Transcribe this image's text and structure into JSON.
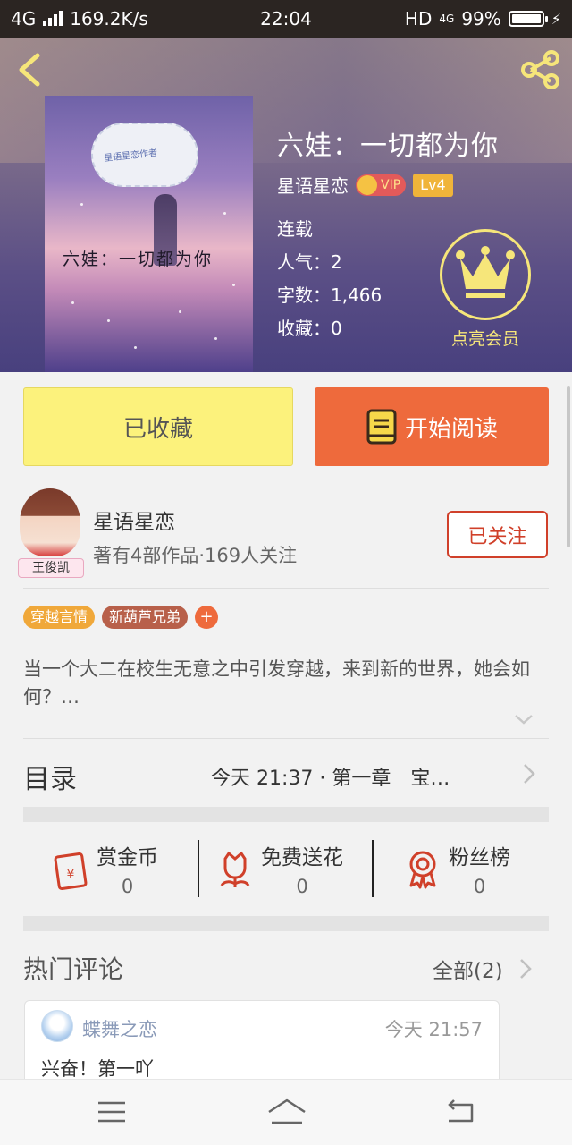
{
  "status_bar": {
    "network": "4G",
    "speed": "169.2K/s",
    "time": "22:04",
    "hd": "HD",
    "network_small": "4G",
    "battery": "99%"
  },
  "book": {
    "title": "六娃：一切都为你",
    "author": "星语星恋",
    "vip_label": "VIP",
    "level": "Lv4",
    "status": "连载",
    "popularity": "人气：2",
    "word_count": "字数：1,466",
    "favorites": "收藏：0",
    "membership_label": "点亮会员",
    "cover_title": "六娃：一切都为你",
    "cover_cloud_text": "星语星恋作者"
  },
  "actions": {
    "collected_label": "已收藏",
    "read_label": "开始阅读"
  },
  "author_card": {
    "name": "星语星恋",
    "stats": "著有4部作品·169人关注",
    "avatar_tag": "王俊凯",
    "follow_label": "已关注"
  },
  "tags": [
    {
      "label": "穿越言情",
      "color": "#f0a83a"
    },
    {
      "label": "新葫芦兄弟",
      "color": "#b8604a"
    }
  ],
  "tag_add": "+",
  "synopsis": "当一个大二在校生无意之中引发穿越，来到新的世界，她会如何？…",
  "toc": {
    "title": "目录",
    "latest": "今天 21:37 · 第一章　宝…"
  },
  "rewards": [
    {
      "label": "赏金币",
      "count": "0",
      "icon": "red-envelope-icon"
    },
    {
      "label": "免费送花",
      "count": "0",
      "icon": "flower-icon"
    },
    {
      "label": "粉丝榜",
      "count": "0",
      "icon": "medal-icon"
    }
  ],
  "comments_section": {
    "title": "热门评论",
    "all_label": "全部(2)"
  },
  "comments": [
    {
      "user": "蝶舞之恋",
      "time": "今天 21:57",
      "text": "兴奋！第一吖"
    }
  ],
  "colors": {
    "accent_orange": "#ee6a3c",
    "collected_yellow": "#fcf27c",
    "follow_red": "#d0402a",
    "crown_yellow": "#f6e67a"
  }
}
